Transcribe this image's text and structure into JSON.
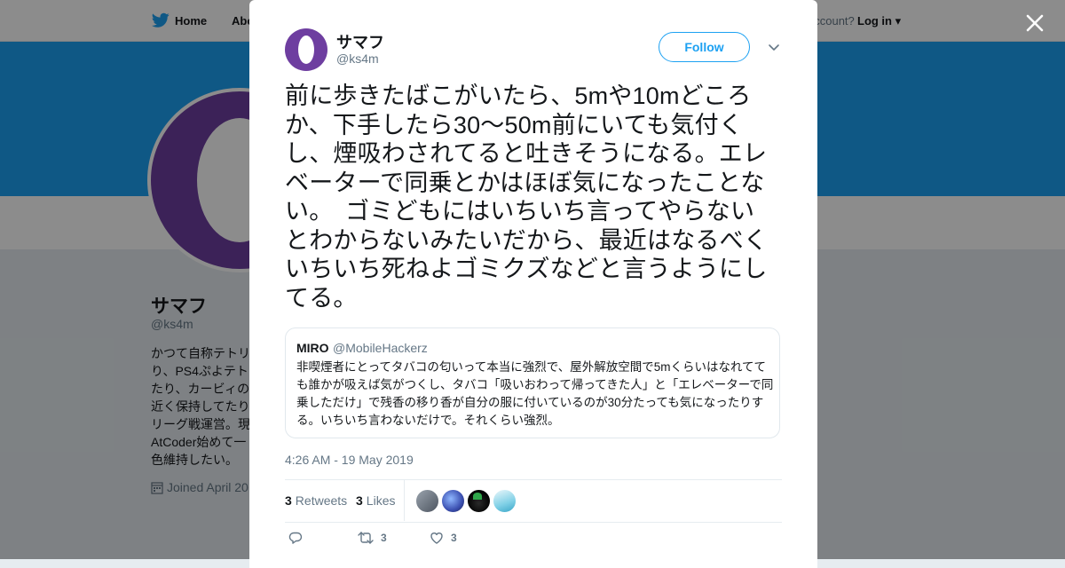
{
  "background_page": {
    "nav": {
      "home_label": "Home",
      "about_label": "Abo",
      "account_prompt": "account?",
      "login_label": "Log in"
    },
    "profile": {
      "name": "サマフ",
      "handle": "@ks4m",
      "bio_visible_fragment": "かつて自称テトリ\nり、PS4ぷよテト\nたり、カービィの\n近く保持してたり\nリーグ戦運営。現\nAtCoder始めて一\n色維持したい。",
      "joined": "Joined April 20"
    },
    "colors": {
      "banner": "#1da1f2",
      "avatar": "#6e3ea0"
    }
  },
  "tweet": {
    "author_name": "サマフ",
    "author_handle": "@ks4m",
    "follow_label": "Follow",
    "text": "前に歩きたばこがいたら、5mや10mどころか、下手したら30～50m前にいても気付くし、煙吸わされてると吐きそうになる。エレベーターで同乗とかはほぼ気になったことない。　ゴミどもにはいちいち言ってやらないとわからないみたいだから、最近はなるべくいちいち死ねよゴミクズなどと言うようにしてる。",
    "quoted": {
      "name": "MIRO",
      "handle": "@MobileHackerz",
      "text": "非喫煙者にとってタバコの匂いって本当に強烈で、屋外解放空間で5mくらいはなれてても誰かが吸えば気がつくし、タバコ「吸いおわって帰ってきた人」と「エレベーターで同乗しただけ」で残香の移り香が自分の服に付いているのが30分たっても気になったりする。いちいち言わないだけで。それくらい強烈。"
    },
    "timestamp": "4:26 AM - 19 May 2019",
    "retweets_count": "3",
    "retweets_label": "Retweets",
    "likes_count": "3",
    "likes_label": "Likes",
    "actions": {
      "retweet_count": "3",
      "like_count": "3"
    },
    "icons": [
      "reply-icon",
      "retweet-icon",
      "heart-icon",
      "chevron-down-icon",
      "close-icon",
      "twitter-bird-icon"
    ],
    "accent_color": "#1da1f2"
  }
}
